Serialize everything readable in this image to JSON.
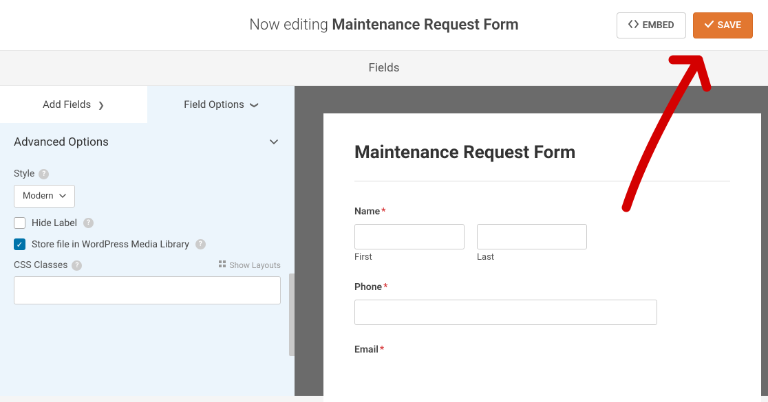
{
  "header": {
    "editing_prefix": "Now editing ",
    "form_name": "Maintenance Request Form",
    "embed_label": "EMBED",
    "save_label": "SAVE"
  },
  "section_title": "Fields",
  "tabs": {
    "add_fields": "Add Fields",
    "field_options": "Field Options"
  },
  "panel": {
    "advanced_options": "Advanced Options",
    "style_label": "Style",
    "style_value": "Modern",
    "hide_label": "Hide Label",
    "store_file": "Store file in WordPress Media Library",
    "css_classes_label": "CSS Classes",
    "show_layouts": "Show Layouts",
    "css_classes_value": ""
  },
  "form": {
    "title": "Maintenance Request Form",
    "name_label": "Name",
    "first_label": "First",
    "last_label": "Last",
    "phone_label": "Phone",
    "email_label": "Email"
  }
}
